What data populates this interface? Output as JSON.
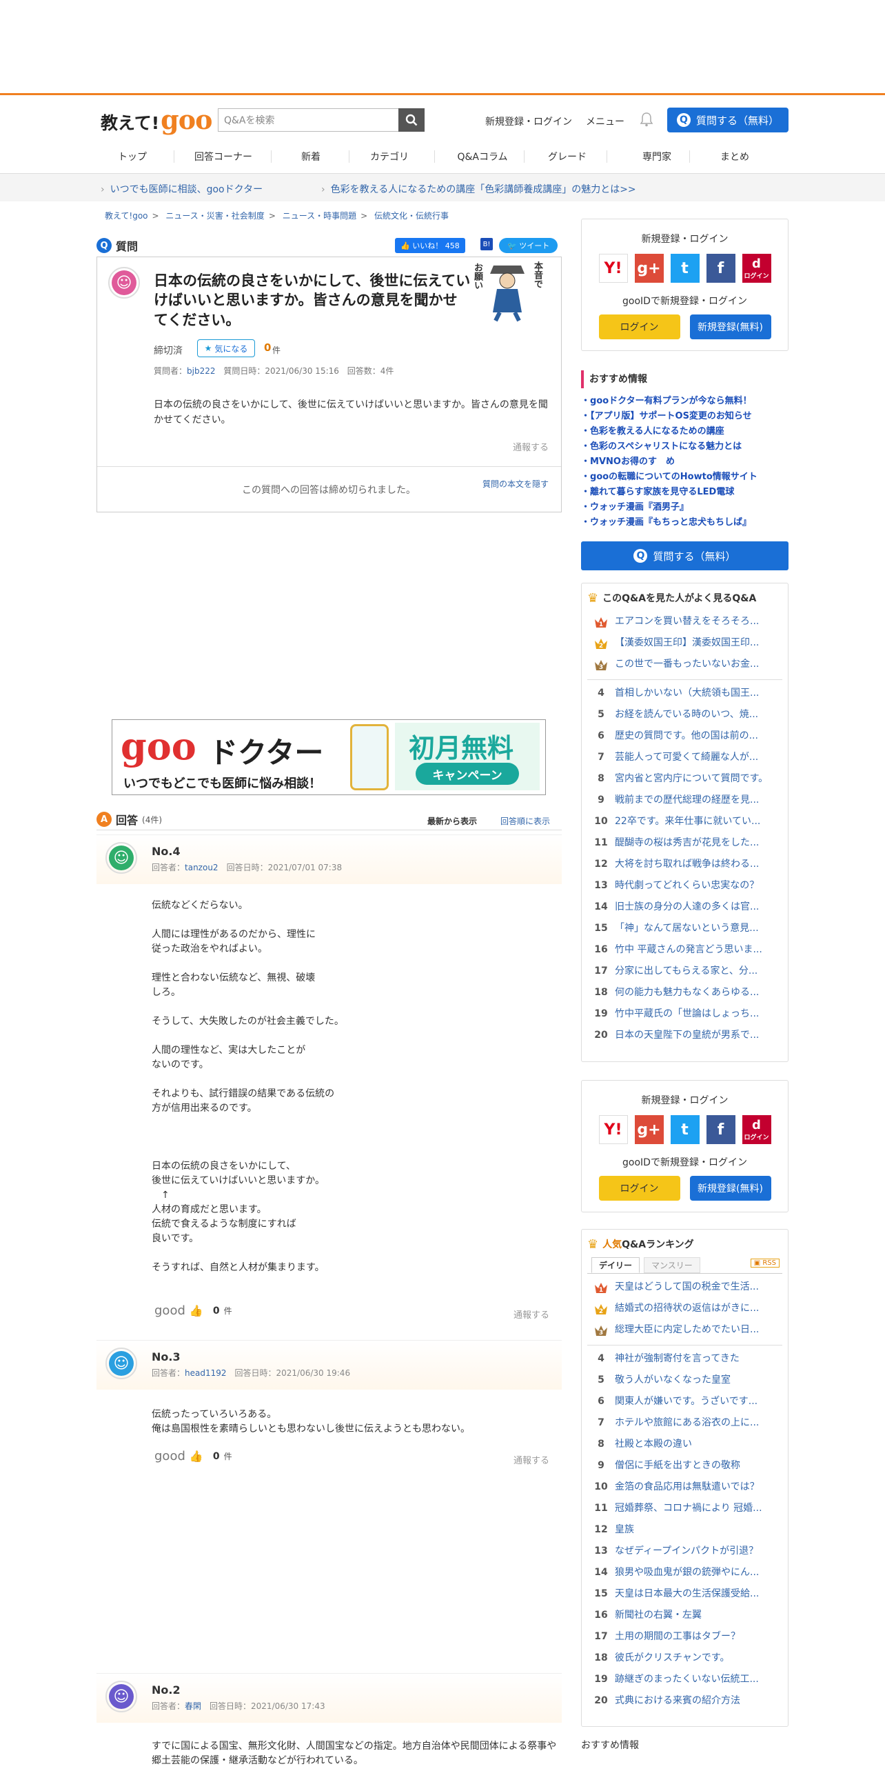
{
  "header": {
    "logo_text": "教えて!",
    "logo_goo": "goo",
    "search_placeholder": "Q&Aを検索",
    "register_login": "新規登録・ログイン",
    "menu": "メニュー",
    "ask_button": "質問する（無料）"
  },
  "gnav": [
    "トップ",
    "回答コーナー",
    "新着",
    "カテゴリ",
    "Q&Aコラム",
    "グレード",
    "専門家",
    "まとめ"
  ],
  "subbar": [
    "いつでも医師に相談、gooドクター",
    "色彩を教える人になるための講座「色彩講師養成講座」の魅力とは>>"
  ],
  "breadcrumb": [
    "教えて!goo",
    "ニュース・災害・社会制度",
    "ニュース・時事問題",
    "伝統文化・伝統行事"
  ],
  "question": {
    "section_label": "質問",
    "like_label": "いいね！ 458",
    "tweet_label": "ツイート",
    "title": "日本の伝統の良さをいかにして、後世に伝えていけばいいと思いますか。皆さんの意見を聞かせてください。",
    "status": "締切済",
    "watch_label": "気になる",
    "watch_count": "0",
    "watch_unit": "件",
    "meta_asker_label": "質問者：",
    "meta_asker": "bjb222",
    "meta_date": "質問日時：2021/06/30 15:16",
    "meta_count": "回答数：4件",
    "body": "日本の伝統の良さをいかにして、後世に伝えていけばいいと思いますか。皆さんの意見を聞かせてください。",
    "report": "通報する",
    "closed_msg": "この質問への回答は締め切られました。",
    "hide_body": "質問の本文を隠す",
    "illustration_text_1": "本音で",
    "illustration_text_2": "お願い"
  },
  "banner": {
    "brand_goo": "goo",
    "brand_doctor": "ドクター",
    "tagline": "いつでもどこでも医師に悩み相談！",
    "promo_title": "初月無料",
    "promo_sub": "キャンペーン"
  },
  "answers_header": {
    "label": "回答",
    "count": "(4件)",
    "sort_new": "最新から表示",
    "sort_order": "回答順に表示"
  },
  "answers": [
    {
      "no": "No.4",
      "answerer_label": "回答者：",
      "answerer": "tanzou2",
      "date": "回答日時：2021/07/01 07:38",
      "body": "伝統などくだらない。\n\n人間には理性があるのだから、理性に\n従った政治をやればよい。\n\n理性と合わない伝統など、無視、破壊\nしろ。\n\nそうして、大失敗したのが社会主義でした。\n\n人間の理性など、実は大したことが\nないのです。\n\nそれよりも、試行錯誤の結果である伝統の\n方が信用出来るのです。\n\n\n\n日本の伝統の良さをいかにして、\n後世に伝えていけばいいと思いますか。\n　↑\n人材の育成だと思います。\n伝統で食えるような制度にすれば\n良いです。\n\nそうすれば、自然と人材が集まります。",
      "good_label": "good",
      "good_count": "0",
      "good_unit": "件",
      "report": "通報する"
    },
    {
      "no": "No.3",
      "answerer_label": "回答者：",
      "answerer": "head1192",
      "date": "回答日時：2021/06/30 19:46",
      "body": "伝統ったっていろいろある。\n俺は島国根性を素晴らしいとも思わないし後世に伝えようとも思わない。",
      "good_label": "good",
      "good_count": "0",
      "good_unit": "件",
      "report": "通報する"
    },
    {
      "no": "No.2",
      "answerer_label": "回答者：",
      "answerer": "春閑",
      "date": "回答日時：2021/06/30 17:43",
      "body": "すでに国による国宝、無形文化財、人間国宝などの指定。地方自治体や民間団体による祭事や郷土芸能の保護・継承活動などが行われている。"
    }
  ],
  "sidebar": {
    "login_title": "新規登録・ログイン",
    "goo_id_text": "gooIDで新規登録・ログイン",
    "login_btn": "ログイン",
    "register_btn": "新規登録(無料)",
    "docomo_label": "ログイン",
    "recommend_title": "おすすめ情報",
    "recommend": [
      "gooドクター有料プランが今なら無料！",
      "【アプリ版】サポートOS変更のお知らせ",
      "色彩を教える人になるための講座",
      "色彩のスペシャリストになる魅力とは",
      "MVNOお得のす　め",
      "gooの転職についてのHowto情報サイト",
      "離れて暮らす家族を見守るLED電球",
      "ウォッチ漫画『酒男子』",
      "ウォッチ漫画『もちっと忠犬もちしば』"
    ],
    "ask_button": "質問する（無料）",
    "related_title": "このQ&Aを見た人がよく見るQ&A",
    "related": [
      "エアコンを買い替えをそろそろ...",
      "【漢委奴国王印】漢委奴国王印...",
      "この世で一番もったいないお金...",
      "首相しかいない（大統領も国王...",
      "お経を読んでいる時のいつ、焼...",
      "歴史の質問です。他の国は前の...",
      "芸能人って可愛くて綺麗な人が...",
      "宮内省と宮内庁について質問です。",
      "戦前までの歴代総理の経歴を見...",
      "22卒です。来年仕事に就いてい...",
      "醍醐寺の桜は秀吉が花見をした...",
      "大将を討ち取れば戦争は終わる...",
      "時代劇ってどれくらい忠実なの？",
      "旧士族の身分の人達の多くは官...",
      "「神」なんて居ないという意見...",
      "竹中 平蔵さんの発言どう思いま...",
      "分家に出してもらえる家と、分...",
      "何の能力も魅力もなくあらゆる...",
      "竹中平蔵氏の「世論はしょっち...",
      "日本の天皇陛下の皇統が男系で..."
    ],
    "ranking_title_a": "人気",
    "ranking_title_b": "Q&Aランキング",
    "ranking_tabs": [
      "デイリー",
      "マンスリー"
    ],
    "rss": "RSS",
    "ranking": [
      "天皇はどうして国の税金で生活...",
      "結婚式の招待状の返信はがきに...",
      "総理大臣に内定しためでたい日...",
      "神社が強制寄付を言ってきた",
      "敬う人がいなくなった皇室",
      "関東人が嫌いです。うざいです...",
      "ホテルや旅館にある浴衣の上に...",
      "社殿と本殿の違い",
      "僧侶に手紙を出すときの敬称",
      "金箔の食品応用は無駄遣いでは？",
      "冠婚葬祭、コロナ禍により 冠婚...",
      "皇族",
      "なぜディープインパクトが引退？",
      "狼男や吸血鬼が銀の銃弾やにん...",
      "天皇は日本最大の生活保護受給...",
      "新聞社の右翼・左翼",
      "土用の期間の工事はタブー？",
      "彼氏がクリスチャンです。",
      "跡継ぎのまったくいない伝統工...",
      "式典における来賓の紹介方法"
    ],
    "recommend_title_2": "おすすめ情報"
  },
  "colors": {
    "accent_orange": "#f08020",
    "link_blue": "#3366aa",
    "primary_blue": "#1a6fd6",
    "login_yellow": "#f5c518"
  }
}
